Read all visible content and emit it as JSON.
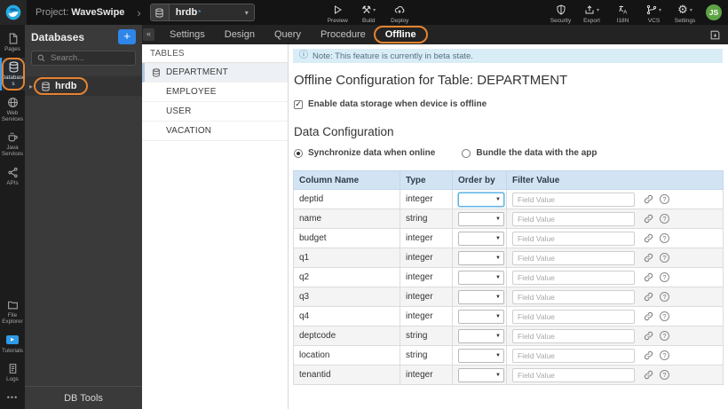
{
  "colors": {
    "highlight_ring": "#e6832f",
    "accent_blue": "#2e86e8",
    "note_bg": "#d9edf7",
    "header_bg": "#d2e4f4",
    "avatar_bg": "#5ca344"
  },
  "topbar": {
    "project_prefix": "Project:",
    "project_name": "WaveSwipe",
    "db_selector": {
      "value": "hrdb",
      "modified_marker": "*"
    },
    "actions_left": [
      {
        "label": "Preview",
        "icon": "play-icon",
        "caret": false
      },
      {
        "label": "Build",
        "icon": "build-icon",
        "caret": true
      },
      {
        "label": "Deploy",
        "icon": "deploy-icon",
        "caret": false
      }
    ],
    "actions_right": [
      {
        "label": "Security",
        "icon": "shield-icon",
        "caret": false
      },
      {
        "label": "Export",
        "icon": "export-icon",
        "caret": true
      },
      {
        "label": "I18N",
        "icon": "i18n-icon",
        "caret": false
      },
      {
        "label": "VCS",
        "icon": "vcs-icon",
        "caret": true
      },
      {
        "label": "Settings",
        "icon": "gear-icon",
        "caret": true
      }
    ],
    "avatar": "JS"
  },
  "sidebar": {
    "top_items": [
      {
        "label": "Pages",
        "icon": "pages-icon",
        "active": false,
        "highlighted": false
      },
      {
        "label": "Databases",
        "icon": "database-icon",
        "active": true,
        "highlighted": true
      },
      {
        "label": "Web Services",
        "icon": "globe-icon",
        "active": false,
        "highlighted": false
      },
      {
        "label": "Java Services",
        "icon": "coffee-icon",
        "active": false,
        "highlighted": false
      },
      {
        "label": "APIs",
        "icon": "share-nodes-icon",
        "active": false,
        "highlighted": false
      }
    ],
    "bottom_items": [
      {
        "label": "File Explorer",
        "icon": "folder-icon",
        "active": false,
        "highlighted": false
      },
      {
        "label": "Tutorials",
        "icon": "tutorials-icon",
        "active": false,
        "highlighted": false
      },
      {
        "label": "Logs",
        "icon": "logs-icon",
        "active": false,
        "highlighted": false
      }
    ],
    "more_label": "•••"
  },
  "db_panel": {
    "title": "Databases",
    "add_button": "+",
    "search_placeholder": "Search...",
    "items": [
      {
        "label": "hrdb",
        "highlighted": true
      }
    ],
    "footer": "DB Tools"
  },
  "tabbar": {
    "collapse_label": "«",
    "tabs": [
      {
        "label": "Settings"
      },
      {
        "label": "Design"
      },
      {
        "label": "Query"
      },
      {
        "label": "Procedure"
      },
      {
        "label": "Offline"
      }
    ],
    "active_tab": "Offline"
  },
  "tables_panel": {
    "header": "TABLES",
    "items": [
      {
        "label": "DEPARTMENT"
      },
      {
        "label": "EMPLOYEE"
      },
      {
        "label": "USER"
      },
      {
        "label": "VACATION"
      }
    ],
    "active_item": "DEPARTMENT"
  },
  "main": {
    "note": "Note: This feature is currently in beta state.",
    "title": "Offline Configuration for Table: DEPARTMENT",
    "enable_checkbox": {
      "label": "Enable data storage when device is offline",
      "checked": true,
      "check_glyph": "✓"
    },
    "section_title": "Data Configuration",
    "radios": [
      {
        "label": "Synchronize data when online",
        "selected": true
      },
      {
        "label": "Bundle the data with the app",
        "selected": false
      }
    ],
    "table": {
      "headers": [
        "Column Name",
        "Type",
        "Order by",
        "Filter Value"
      ],
      "filter_placeholder": "Field Value",
      "order_by_value": "",
      "focused_row_index": 0,
      "rows": [
        {
          "name": "deptid",
          "type": "integer"
        },
        {
          "name": "name",
          "type": "string"
        },
        {
          "name": "budget",
          "type": "integer"
        },
        {
          "name": "q1",
          "type": "integer"
        },
        {
          "name": "q2",
          "type": "integer"
        },
        {
          "name": "q3",
          "type": "integer"
        },
        {
          "name": "q4",
          "type": "integer"
        },
        {
          "name": "deptcode",
          "type": "string"
        },
        {
          "name": "location",
          "type": "string"
        },
        {
          "name": "tenantid",
          "type": "integer"
        }
      ]
    }
  }
}
